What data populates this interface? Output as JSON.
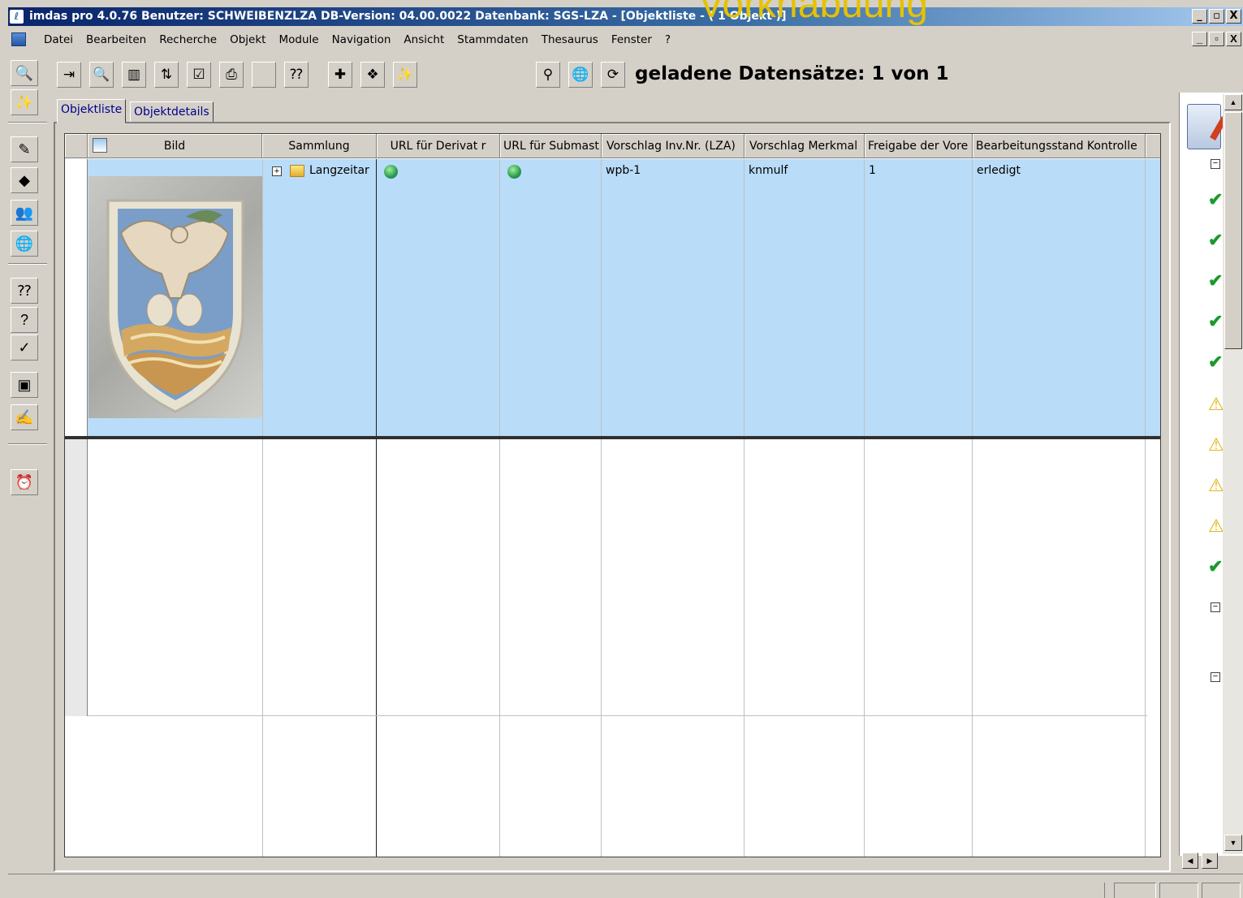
{
  "window": {
    "title": "imdas pro 4.0.76  Benutzer: SCHWEIBENZLZA  DB-Version: 04.00.0022  Datenbank: SGS-LZA - [Objektliste - ( 1 Objekt )]",
    "overlay_text": "Vorkhabuung",
    "min": "_",
    "max": "▫",
    "close": "X"
  },
  "menu": [
    "Datei",
    "Bearbeiten",
    "Recherche",
    "Objekt",
    "Module",
    "Navigation",
    "Ansicht",
    "Stammdaten",
    "Thesaurus",
    "Fenster",
    "?"
  ],
  "toolbar": {
    "records_label": "geladene Datensätze: 1 von 1"
  },
  "tabs": [
    {
      "label": "Objektliste",
      "active": true
    },
    {
      "label": "Objektdetails",
      "active": false
    }
  ],
  "table": {
    "columns": [
      "Bild",
      "Sammlung",
      "URL für Derivat r",
      "URL für Submast",
      "Vorschlag Inv.Nr. (LZA)",
      "Vorschlag Merkmal",
      "Freigabe der Vore",
      "Bearbeitungsstand Kontrolle"
    ],
    "rows": [
      {
        "sammlung": "Langzeitar",
        "vorschlag_inv": "wpb-1",
        "vorschlag_merkmal": "knmulf",
        "freigabe": "1",
        "bearbeitungsstand": "erledigt"
      }
    ]
  },
  "right_panel": {
    "status_icons": [
      "ok",
      "ok",
      "ok",
      "ok",
      "ok",
      "warn",
      "warn",
      "warn",
      "warn",
      "ok"
    ]
  },
  "colors": {
    "selection": "#b9dcf8",
    "titlebar": "#0a246a",
    "ok": "#1a9a2a",
    "warn": "#e0b000"
  }
}
